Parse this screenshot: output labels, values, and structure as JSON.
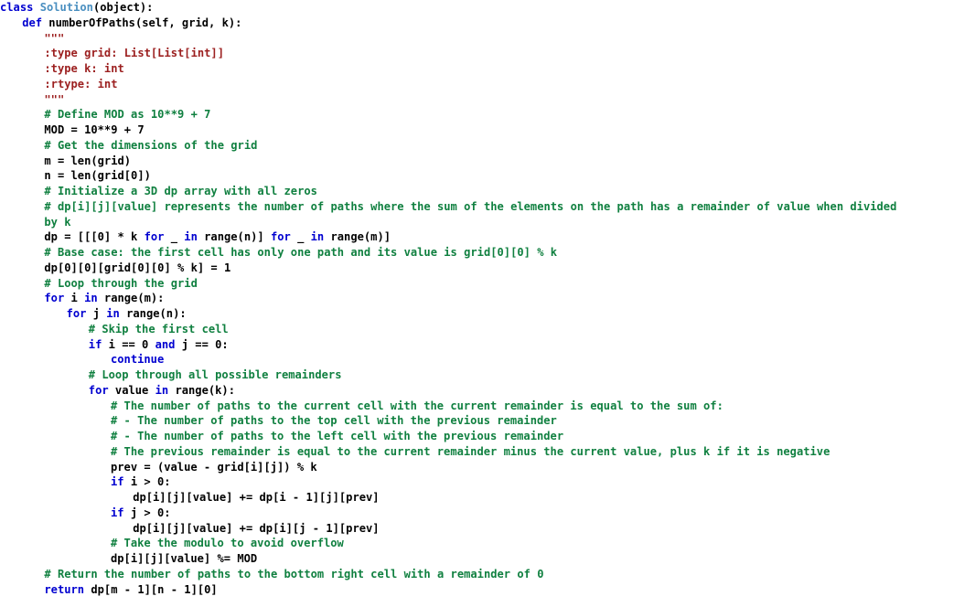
{
  "editor": {
    "language": "Python",
    "background_color": "#ffffff",
    "font_size_px": 12,
    "line_height_px": 16.75,
    "colors": {
      "keyword": "#0000d0",
      "class_name": "#4a8fc0",
      "comment": "#108040",
      "string": "#9c2020",
      "plain": "#000000"
    }
  },
  "code": {
    "lines": [
      {
        "indent": 0,
        "tokens": [
          {
            "t": "kw",
            "s": "class"
          },
          {
            "t": "plain",
            "s": " "
          },
          {
            "t": "cls",
            "s": "Solution"
          },
          {
            "t": "plain",
            "s": "(object):"
          }
        ]
      },
      {
        "indent": 4,
        "tokens": [
          {
            "t": "kw",
            "s": "def"
          },
          {
            "t": "plain",
            "s": " numberOfPaths(self, grid, k):"
          }
        ]
      },
      {
        "indent": 8,
        "tokens": [
          {
            "t": "str",
            "s": "\"\"\""
          }
        ]
      },
      {
        "indent": 8,
        "tokens": [
          {
            "t": "str",
            "s": ":type grid: List[List[int]]"
          }
        ]
      },
      {
        "indent": 8,
        "tokens": [
          {
            "t": "str",
            "s": ":type k: int"
          }
        ]
      },
      {
        "indent": 8,
        "tokens": [
          {
            "t": "str",
            "s": ":rtype: int"
          }
        ]
      },
      {
        "indent": 8,
        "tokens": [
          {
            "t": "str",
            "s": "\"\"\""
          }
        ]
      },
      {
        "indent": 8,
        "tokens": [
          {
            "t": "cmt",
            "s": "# Define MOD as 10**9 + 7"
          }
        ]
      },
      {
        "indent": 8,
        "tokens": [
          {
            "t": "plain",
            "s": "MOD = 10**9 + 7"
          }
        ]
      },
      {
        "indent": 8,
        "tokens": [
          {
            "t": "cmt",
            "s": "# Get the dimensions of the grid"
          }
        ]
      },
      {
        "indent": 8,
        "tokens": [
          {
            "t": "plain",
            "s": "m = len(grid)"
          }
        ]
      },
      {
        "indent": 8,
        "tokens": [
          {
            "t": "plain",
            "s": "n = len(grid[0])"
          }
        ]
      },
      {
        "indent": 8,
        "tokens": [
          {
            "t": "cmt",
            "s": "# Initialize a 3D dp array with all zeros"
          }
        ]
      },
      {
        "indent": 8,
        "tokens": [
          {
            "t": "cmt",
            "s": "# dp[i][j][value] represents the number of paths where the sum of the elements on the path has a remainder of value when divided"
          }
        ]
      },
      {
        "indent": 8,
        "tokens": [
          {
            "t": "cmt",
            "s": "by k"
          }
        ]
      },
      {
        "indent": 8,
        "tokens": [
          {
            "t": "plain",
            "s": "dp = [[[0] * k "
          },
          {
            "t": "kw",
            "s": "for"
          },
          {
            "t": "plain",
            "s": " _ "
          },
          {
            "t": "kw",
            "s": "in"
          },
          {
            "t": "plain",
            "s": " range(n)] "
          },
          {
            "t": "kw",
            "s": "for"
          },
          {
            "t": "plain",
            "s": " _ "
          },
          {
            "t": "kw",
            "s": "in"
          },
          {
            "t": "plain",
            "s": " range(m)]"
          }
        ]
      },
      {
        "indent": 8,
        "tokens": [
          {
            "t": "cmt",
            "s": "# Base case: the first cell has only one path and its value is grid[0][0] % k"
          }
        ]
      },
      {
        "indent": 8,
        "tokens": [
          {
            "t": "plain",
            "s": "dp[0][0][grid[0][0] % k] = 1"
          }
        ]
      },
      {
        "indent": 8,
        "tokens": [
          {
            "t": "cmt",
            "s": "# Loop through the grid"
          }
        ]
      },
      {
        "indent": 8,
        "tokens": [
          {
            "t": "kw",
            "s": "for"
          },
          {
            "t": "plain",
            "s": " i "
          },
          {
            "t": "kw",
            "s": "in"
          },
          {
            "t": "plain",
            "s": " range(m):"
          }
        ]
      },
      {
        "indent": 12,
        "tokens": [
          {
            "t": "kw",
            "s": "for"
          },
          {
            "t": "plain",
            "s": " j "
          },
          {
            "t": "kw",
            "s": "in"
          },
          {
            "t": "plain",
            "s": " range(n):"
          }
        ]
      },
      {
        "indent": 16,
        "tokens": [
          {
            "t": "cmt",
            "s": "# Skip the first cell"
          }
        ]
      },
      {
        "indent": 16,
        "tokens": [
          {
            "t": "kw",
            "s": "if"
          },
          {
            "t": "plain",
            "s": " i == 0 "
          },
          {
            "t": "kw",
            "s": "and"
          },
          {
            "t": "plain",
            "s": " j == 0:"
          }
        ]
      },
      {
        "indent": 20,
        "tokens": [
          {
            "t": "kw",
            "s": "continue"
          }
        ]
      },
      {
        "indent": 16,
        "tokens": [
          {
            "t": "cmt",
            "s": "# Loop through all possible remainders"
          }
        ]
      },
      {
        "indent": 16,
        "tokens": [
          {
            "t": "kw",
            "s": "for"
          },
          {
            "t": "plain",
            "s": " value "
          },
          {
            "t": "kw",
            "s": "in"
          },
          {
            "t": "plain",
            "s": " range(k):"
          }
        ]
      },
      {
        "indent": 20,
        "tokens": [
          {
            "t": "cmt",
            "s": "# The number of paths to the current cell with the current remainder is equal to the sum of:"
          }
        ]
      },
      {
        "indent": 20,
        "tokens": [
          {
            "t": "cmt",
            "s": "# - The number of paths to the top cell with the previous remainder"
          }
        ]
      },
      {
        "indent": 20,
        "tokens": [
          {
            "t": "cmt",
            "s": "# - The number of paths to the left cell with the previous remainder"
          }
        ]
      },
      {
        "indent": 20,
        "tokens": [
          {
            "t": "cmt",
            "s": "# The previous remainder is equal to the current remainder minus the current value, plus k if it is negative"
          }
        ]
      },
      {
        "indent": 20,
        "tokens": [
          {
            "t": "plain",
            "s": "prev = (value - grid[i][j]) % k"
          }
        ]
      },
      {
        "indent": 20,
        "tokens": [
          {
            "t": "kw",
            "s": "if"
          },
          {
            "t": "plain",
            "s": " i > 0:"
          }
        ]
      },
      {
        "indent": 24,
        "tokens": [
          {
            "t": "plain",
            "s": "dp[i][j][value] += dp[i - 1][j][prev]"
          }
        ]
      },
      {
        "indent": 20,
        "tokens": [
          {
            "t": "kw",
            "s": "if"
          },
          {
            "t": "plain",
            "s": " j > 0:"
          }
        ]
      },
      {
        "indent": 24,
        "tokens": [
          {
            "t": "plain",
            "s": "dp[i][j][value] += dp[i][j - 1][prev]"
          }
        ]
      },
      {
        "indent": 20,
        "tokens": [
          {
            "t": "cmt",
            "s": "# Take the modulo to avoid overflow"
          }
        ]
      },
      {
        "indent": 20,
        "tokens": [
          {
            "t": "plain",
            "s": "dp[i][j][value] %= MOD"
          }
        ]
      },
      {
        "indent": 8,
        "tokens": [
          {
            "t": "cmt",
            "s": "# Return the number of paths to the bottom right cell with a remainder of 0"
          }
        ]
      },
      {
        "indent": 8,
        "tokens": [
          {
            "t": "kw",
            "s": "return"
          },
          {
            "t": "plain",
            "s": " dp[m - 1][n - 1][0]"
          }
        ]
      }
    ]
  }
}
